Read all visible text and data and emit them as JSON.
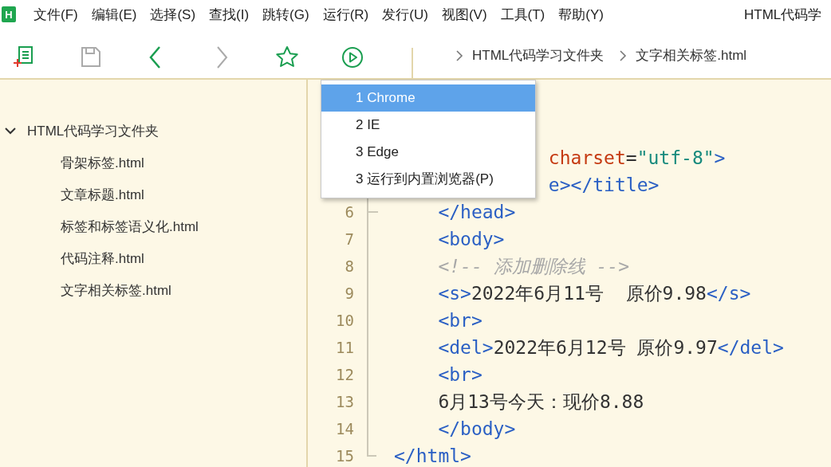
{
  "menu_bar": {
    "logo": "H",
    "items": [
      "文件(F)",
      "编辑(E)",
      "选择(S)",
      "查找(I)",
      "跳转(G)",
      "运行(R)",
      "发行(U)",
      "视图(V)",
      "工具(T)",
      "帮助(Y)"
    ],
    "title": "HTML代码学"
  },
  "toolbar": {
    "buttons": [
      {
        "kind": "new-file",
        "disabled": false
      },
      {
        "kind": "save",
        "disabled": true
      },
      {
        "kind": "back",
        "disabled": false
      },
      {
        "kind": "forward",
        "disabled": true
      },
      {
        "kind": "favorite",
        "disabled": false
      },
      {
        "kind": "run",
        "disabled": false
      }
    ],
    "breadcrumb": [
      "HTML代码学习文件夹",
      "文字相关标签.html"
    ]
  },
  "sidebar": {
    "tree": [
      {
        "label": "HTML代码学习文件夹",
        "expanded": true,
        "children": [
          {
            "label": "骨架标签.html"
          },
          {
            "label": "文章标题.html"
          },
          {
            "label": "标签和标签语义化.html"
          },
          {
            "label": "代码注释.html"
          },
          {
            "label": "文字相关标签.html"
          }
        ]
      }
    ]
  },
  "editor": {
    "lines": [
      {
        "kind": "partial",
        "segments": [
          {
            "kind": "attr",
            "text": "charset"
          },
          {
            "kind": "plain",
            "text": "="
          },
          {
            "kind": "string",
            "text": "\"utf-8\""
          },
          {
            "kind": "tag",
            "text": ">"
          }
        ]
      },
      {
        "kind": "partial",
        "segments": [
          {
            "kind": "tag",
            "text": "e></title>"
          }
        ]
      },
      {
        "kind": "nested",
        "number": "6",
        "segments": [
          {
            "kind": "tag",
            "text": "</head>"
          }
        ]
      },
      {
        "kind": "nested",
        "number": "7",
        "segments": [
          {
            "kind": "tag",
            "text": "<body>"
          }
        ]
      },
      {
        "kind": "nested",
        "number": "8",
        "segments": [
          {
            "kind": "comment",
            "text": "<!-- 添加删除线 -->"
          }
        ]
      },
      {
        "kind": "nested",
        "number": "9",
        "segments": [
          {
            "kind": "tag",
            "text": "<s>"
          },
          {
            "kind": "plain",
            "text": "2022年6月11号  原价9.98"
          },
          {
            "kind": "tag",
            "text": "</s>"
          }
        ]
      },
      {
        "kind": "nested",
        "number": "10",
        "segments": [
          {
            "kind": "tag",
            "text": "<br>"
          }
        ]
      },
      {
        "kind": "nested",
        "number": "11",
        "segments": [
          {
            "kind": "tag",
            "text": "<del>"
          },
          {
            "kind": "plain",
            "text": "2022年6月12号 原价9.97"
          },
          {
            "kind": "tag",
            "text": "</del>"
          }
        ]
      },
      {
        "kind": "nested",
        "number": "12",
        "segments": [
          {
            "kind": "tag",
            "text": "<br>"
          }
        ]
      },
      {
        "kind": "nested",
        "number": "13",
        "segments": [
          {
            "kind": "plain",
            "text": "6月13号今天：现价8.88"
          }
        ]
      },
      {
        "kind": "nested",
        "number": "14",
        "segments": [
          {
            "kind": "tag",
            "text": "</body>"
          }
        ]
      },
      {
        "kind": "top",
        "number": "15",
        "segments": [
          {
            "kind": "tag",
            "text": "</html>"
          }
        ]
      }
    ]
  },
  "run_menu": {
    "items": [
      {
        "label": "1 Chrome",
        "selected": true
      },
      {
        "label": "2 IE",
        "selected": false
      },
      {
        "label": "3 Edge",
        "selected": false
      },
      {
        "label": "3 运行到内置浏览器(P)",
        "selected": false
      }
    ]
  }
}
